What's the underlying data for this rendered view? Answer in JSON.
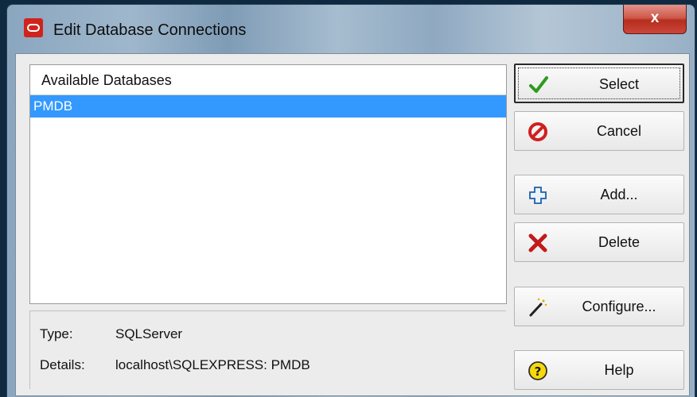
{
  "window": {
    "title": "Edit Database Connections",
    "close_label": "x"
  },
  "databases": {
    "header": "Available Databases",
    "items": [
      {
        "name": "PMDB",
        "selected": true
      }
    ]
  },
  "details": {
    "type_label": "Type:",
    "type_value": "SQLServer",
    "details_label": "Details:",
    "details_value": "localhost\\SQLEXPRESS: PMDB"
  },
  "buttons": {
    "select": "Select",
    "cancel": "Cancel",
    "add": "Add...",
    "delete": "Delete",
    "configure": "Configure...",
    "help": "Help"
  },
  "icons": {
    "app": "oracle-logo-icon",
    "select": "checkmark-icon",
    "cancel": "no-entry-icon",
    "add": "plus-icon",
    "delete": "red-x-icon",
    "configure": "magic-wand-icon",
    "help": "question-icon"
  },
  "colors": {
    "selection": "#3399ff",
    "close": "#c9473a"
  }
}
